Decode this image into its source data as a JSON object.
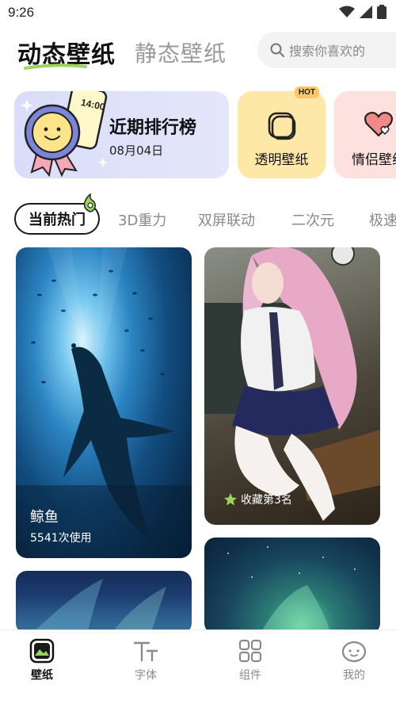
{
  "status_bar": {
    "time": "9:26"
  },
  "header": {
    "tab_dynamic": "动态壁纸",
    "tab_static": "静态壁纸",
    "search_placeholder": "搜索你喜欢的"
  },
  "feature_cards": {
    "ranking": {
      "title": "近期排行榜",
      "date": "08月04日",
      "phone_time": "14:00"
    },
    "transparent": {
      "label": "透明壁纸",
      "badge": "HOT"
    },
    "couple": {
      "label": "情侣壁纸"
    }
  },
  "categories": {
    "active": "当前热门",
    "items": [
      "3D重力",
      "双屏联动",
      "二次元",
      "极速"
    ]
  },
  "wallpapers": {
    "whale": {
      "title": "鲸鱼",
      "usage": "5541次使用"
    },
    "girl": {
      "favorite": "收藏第3名"
    }
  },
  "bottom_nav": {
    "wallpaper": "壁纸",
    "font": "字体",
    "widget": "组件",
    "mine": "我的"
  },
  "colors": {
    "accent_green": "#9ad45b",
    "rank_card_bg": "#dde0fa",
    "clear_card_bg": "#fde8a8",
    "couple_card_bg": "#fde1df"
  }
}
